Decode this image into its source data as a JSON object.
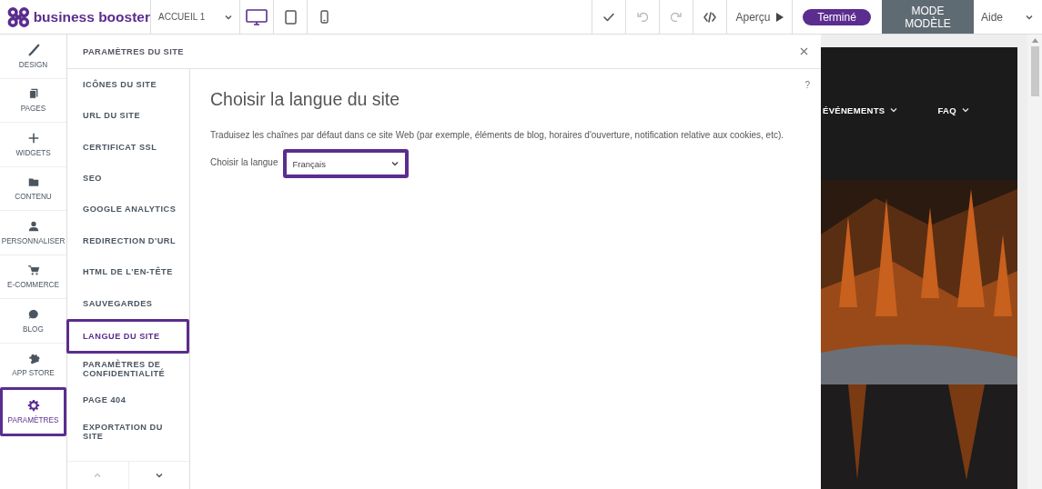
{
  "topbar": {
    "logo": "business booster",
    "page_select": "ACCUEIL 1",
    "devices": [
      {
        "kind": "desktop",
        "selected": true
      },
      {
        "kind": "tablet",
        "selected": false
      },
      {
        "kind": "phone",
        "selected": false
      }
    ],
    "preview": "Aperçu",
    "done": "Terminé",
    "template_mode": "MODE MODÈLE",
    "help": "Aide"
  },
  "rail": [
    {
      "kind": "brush",
      "label": "DESIGN",
      "selected": false
    },
    {
      "kind": "pages",
      "label": "PAGES",
      "selected": false
    },
    {
      "kind": "plus",
      "label": "WIDGETS",
      "selected": false
    },
    {
      "kind": "folder",
      "label": "CONTENU",
      "selected": false
    },
    {
      "kind": "person",
      "label": "PERSONNALISER",
      "selected": false
    },
    {
      "kind": "cart",
      "label": "E-COMMERCE",
      "selected": false
    },
    {
      "kind": "chat",
      "label": "BLOG",
      "selected": false
    },
    {
      "kind": "puzzle",
      "label": "APP STORE",
      "selected": false
    },
    {
      "kind": "gear",
      "label": "PARAMÈTRES",
      "selected": true
    }
  ],
  "settings": {
    "title": "PARAMÈTRES DU SITE",
    "items": [
      {
        "label": "ICÔNES DU SITE",
        "selected": false
      },
      {
        "label": "URL DU SITE",
        "selected": false
      },
      {
        "label": "CERTIFICAT SSL",
        "selected": false
      },
      {
        "label": "SEO",
        "selected": false
      },
      {
        "label": "GOOGLE ANALYTICS",
        "selected": false
      },
      {
        "label": "REDIRECTION D'URL",
        "selected": false
      },
      {
        "label": "HTML DE L'EN-TÊTE",
        "selected": false
      },
      {
        "label": "SAUVEGARDES",
        "selected": false
      },
      {
        "label": "LANGUE DU SITE",
        "selected": true
      },
      {
        "label": "PARAMÈTRES DE CONFIDENTIALITÉ",
        "selected": false
      },
      {
        "label": "PAGE 404",
        "selected": false
      },
      {
        "label": "EXPORTATION DU SITE",
        "selected": false
      }
    ]
  },
  "content": {
    "heading": "Choisir la langue du site",
    "help": "?",
    "description": "Traduisez les chaînes par défaut dans ce site Web (par exemple, éléments de blog, horaires d'ouverture, notification relative aux cookies, etc).",
    "language_label": "Choisir la langue",
    "language_value": "Français"
  },
  "site_preview": {
    "menu": [
      {
        "label": "ÉVÉNEMENTS"
      },
      {
        "label": "FAQ"
      }
    ]
  }
}
